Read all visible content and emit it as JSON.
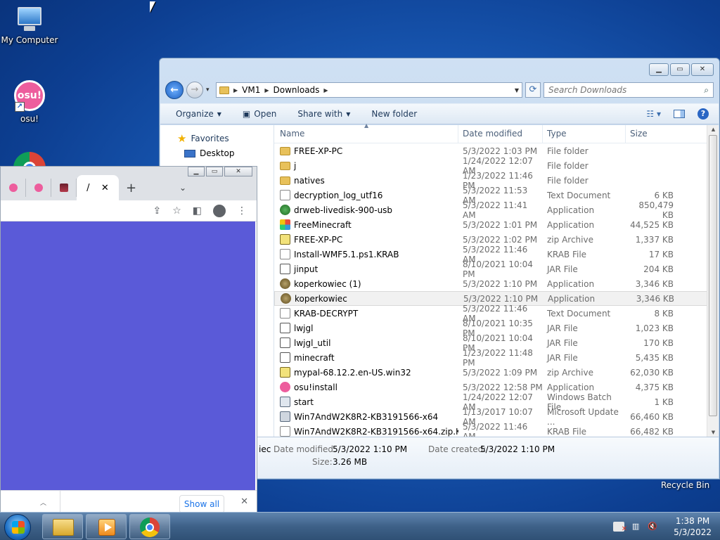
{
  "desktop": {
    "icons": [
      {
        "label": "My Computer"
      },
      {
        "label": "osu!",
        "glyph": "osu!"
      }
    ],
    "recycle_bin": "Recycle Bin"
  },
  "explorer": {
    "breadcrumb": [
      "VM1",
      "Downloads"
    ],
    "search_placeholder": "Search Downloads",
    "toolbar": {
      "organize": "Organize",
      "open": "Open",
      "share_with": "Share with",
      "new_folder": "New folder"
    },
    "nav": {
      "favorites": "Favorites",
      "desktop": "Desktop"
    },
    "columns": {
      "name": "Name",
      "date": "Date modified",
      "type": "Type",
      "size": "Size"
    },
    "files": [
      {
        "name": "FREE-XP-PC",
        "date": "5/3/2022 1:03 PM",
        "type": "File folder",
        "size": "",
        "icon": "folder"
      },
      {
        "name": "j",
        "date": "1/24/2022 12:07 AM",
        "type": "File folder",
        "size": "",
        "icon": "folder"
      },
      {
        "name": "natives",
        "date": "1/23/2022 11:46 PM",
        "type": "File folder",
        "size": "",
        "icon": "folder"
      },
      {
        "name": "decryption_log_utf16",
        "date": "5/3/2022 11:53 AM",
        "type": "Text Document",
        "size": "6 KB",
        "icon": "doc"
      },
      {
        "name": "drweb-livedisk-900-usb",
        "date": "5/3/2022 11:41 AM",
        "type": "Application",
        "size": "850,479 KB",
        "icon": "app-green"
      },
      {
        "name": "FreeMinecraft",
        "date": "5/3/2022 1:01 PM",
        "type": "Application",
        "size": "44,525 KB",
        "icon": "app-color"
      },
      {
        "name": "FREE-XP-PC",
        "date": "5/3/2022 1:02 PM",
        "type": "zip Archive",
        "size": "1,337 KB",
        "icon": "zip"
      },
      {
        "name": "Install-WMF5.1.ps1.KRAB",
        "date": "5/3/2022 11:46 AM",
        "type": "KRAB File",
        "size": "17 KB",
        "icon": "doc"
      },
      {
        "name": "jinput",
        "date": "8/10/2021 10:04 PM",
        "type": "JAR File",
        "size": "204 KB",
        "icon": "jar"
      },
      {
        "name": "koperkowiec (1)",
        "date": "5/3/2022 1:10 PM",
        "type": "Application",
        "size": "3,346 KB",
        "icon": "app-brown"
      },
      {
        "name": "koperkowiec",
        "date": "5/3/2022 1:10 PM",
        "type": "Application",
        "size": "3,346 KB",
        "icon": "app-brown",
        "selected": true
      },
      {
        "name": "KRAB-DECRYPT",
        "date": "5/3/2022 11:46 AM",
        "type": "Text Document",
        "size": "8 KB",
        "icon": "doc"
      },
      {
        "name": "lwjgl",
        "date": "8/10/2021 10:35 PM",
        "type": "JAR File",
        "size": "1,023 KB",
        "icon": "jar"
      },
      {
        "name": "lwjgl_util",
        "date": "8/10/2021 10:04 PM",
        "type": "JAR File",
        "size": "170 KB",
        "icon": "jar"
      },
      {
        "name": "minecraft",
        "date": "1/23/2022 11:48 PM",
        "type": "JAR File",
        "size": "5,435 KB",
        "icon": "jar"
      },
      {
        "name": "mypal-68.12.2.en-US.win32",
        "date": "5/3/2022 1:09 PM",
        "type": "zip Archive",
        "size": "62,030 KB",
        "icon": "zip"
      },
      {
        "name": "osu!install",
        "date": "5/3/2022 12:58 PM",
        "type": "Application",
        "size": "4,375 KB",
        "icon": "osu"
      },
      {
        "name": "start",
        "date": "1/24/2022 12:07 AM",
        "type": "Windows Batch File",
        "size": "1 KB",
        "icon": "bat"
      },
      {
        "name": "Win7AndW2K8R2-KB3191566-x64",
        "date": "1/13/2017 10:07 AM",
        "type": "Microsoft Update ...",
        "size": "66,460 KB",
        "icon": "upd"
      },
      {
        "name": "Win7AndW2K8R2-KB3191566-x64.zip.KRAB",
        "date": "5/3/2022 11:46 AM",
        "type": "KRAB File",
        "size": "66,482 KB",
        "icon": "doc"
      }
    ],
    "details": {
      "name_fragment": "iec",
      "date_modified_label": "Date modified:",
      "date_modified": "5/3/2022 1:10 PM",
      "date_created_label": "Date created:",
      "date_created": "5/3/2022 1:10 PM",
      "size_label": "Size:",
      "size": "3.26 MB",
      "left_fragment": "n"
    }
  },
  "chrome": {
    "active_tab_text": "/",
    "download_bar": {
      "show_all": "Show all"
    },
    "page_bg": "#5a5ad8"
  },
  "taskbar": {
    "time": "1:38 PM",
    "date": "5/3/2022"
  }
}
